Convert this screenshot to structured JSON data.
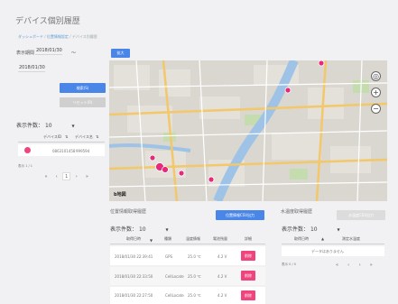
{
  "page": {
    "title": "デバイス個別履歴"
  },
  "breadcrumb": {
    "home": "ダッシュボード",
    "sep": "/",
    "list": "位置情報設定",
    "current": "デバイス別履歴"
  },
  "filters": {
    "period_label": "表示期間",
    "start_date": "2018/01/30",
    "dash": "〜",
    "end_date": "2018/01/30",
    "search_label": "検索(S)",
    "reset_label": "リセット(R)"
  },
  "device_list": {
    "count_label": "表示件数：",
    "count_value": "10",
    "columns": [
      "デバイスID",
      "デバイス名"
    ],
    "rows": [
      {
        "id": "0863101458",
        "name": "999594"
      }
    ],
    "paging_info": "表示 1 / 1",
    "pager": {
      "first": "«",
      "prev": "‹",
      "page": "1",
      "next": "›",
      "last": "»"
    }
  },
  "map_controls": {
    "zoom_in": "+",
    "zoom_out": "−",
    "locate": "◎",
    "expand_label": "拡大",
    "brand": "b地図"
  },
  "position_history": {
    "title": "位置情報取得履歴",
    "export_label": "位置情報CSV出力",
    "count_label": "表示件数：",
    "count_value": "10",
    "columns": [
      "取得日時",
      "種類",
      "温度情報",
      "電池残量",
      "詳細"
    ],
    "rows": [
      {
        "time": "2018/01/30 22:39:41",
        "type": "GPS",
        "temp": "25.0 ℃",
        "battery": "4.2 V",
        "action": "削除"
      },
      {
        "time": "2018/01/30 22:33:50",
        "type": "CellLocate",
        "temp": "25.0 ℃",
        "battery": "4.2 V",
        "action": "削除"
      },
      {
        "time": "2018/01/30 22:27:50",
        "type": "CellLocate",
        "temp": "25.0 ℃",
        "battery": "4.2 V",
        "action": "削除"
      }
    ]
  },
  "temp_history": {
    "title": "水温度取得履歴",
    "export_label": "水温度CSV出力",
    "count_label": "表示件数：",
    "count_value": "10",
    "columns": [
      "取得日時",
      "測定水温度"
    ],
    "empty": "データはありません",
    "paging_info": "表示 0 / 0",
    "pager": {
      "first": "«",
      "prev": "‹",
      "next": "›",
      "last": "»"
    }
  },
  "colors": {
    "accent": "#4a86e8",
    "pink": "#f0447f",
    "bg": "#f1f1f3"
  }
}
